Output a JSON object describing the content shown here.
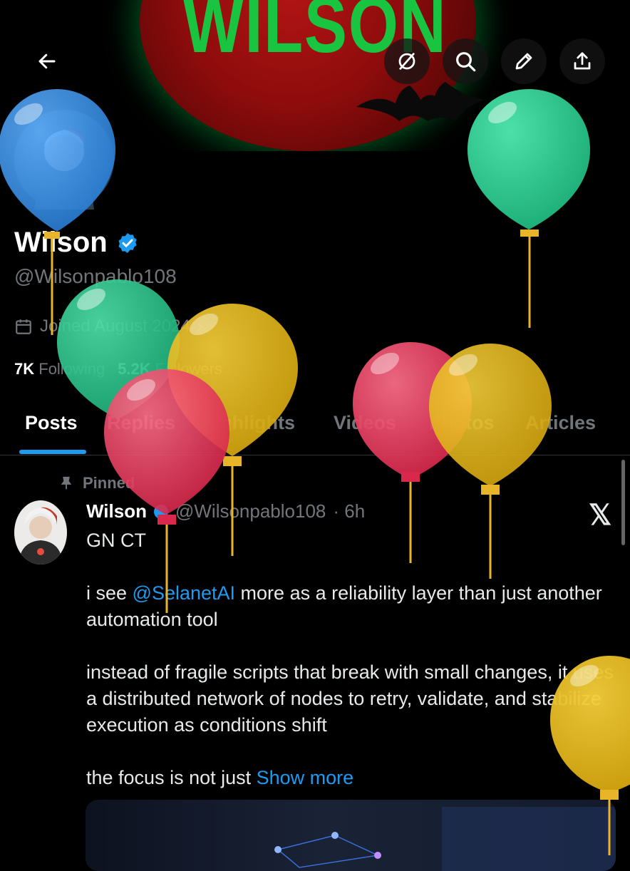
{
  "banner": {
    "title": "WILSON"
  },
  "header": {
    "back_icon": "arrow-left-icon",
    "buttons": [
      "grok-icon",
      "search-icon",
      "edit-icon",
      "share-icon"
    ]
  },
  "profile": {
    "name": "Wilson",
    "handle": "@Wilsonpablo108",
    "joined": "Joined August 2024",
    "following_count": "7K",
    "following_label": "Following",
    "followers_count": "5.2K",
    "followers_label": "Followers"
  },
  "tabs": [
    {
      "label": "Posts"
    },
    {
      "label": "Replies"
    },
    {
      "label": "Highlights"
    },
    {
      "label": "Videos"
    },
    {
      "label": "Photos"
    },
    {
      "label": "Articles"
    }
  ],
  "post": {
    "pinned_label": "Pinned",
    "author_name": "Wilson",
    "author_handle": "@Wilsonpablo108",
    "time": "· 6h",
    "line1": "GN CT",
    "p2_before": "i see ",
    "p2_mention": "@SelanetAI",
    "p2_after": " more as a reliability layer than just another automation tool",
    "p3": "instead of fragile scripts that break with small changes, it uses a distributed network of nodes to retry, validate, and stabilize execution as conditions shift",
    "p4_before": "the focus is not just ",
    "show_more": "Show more"
  },
  "colors": {
    "accent": "#1d9bf0",
    "banner_title": "#18c440",
    "moon": "#8e0c0c"
  }
}
